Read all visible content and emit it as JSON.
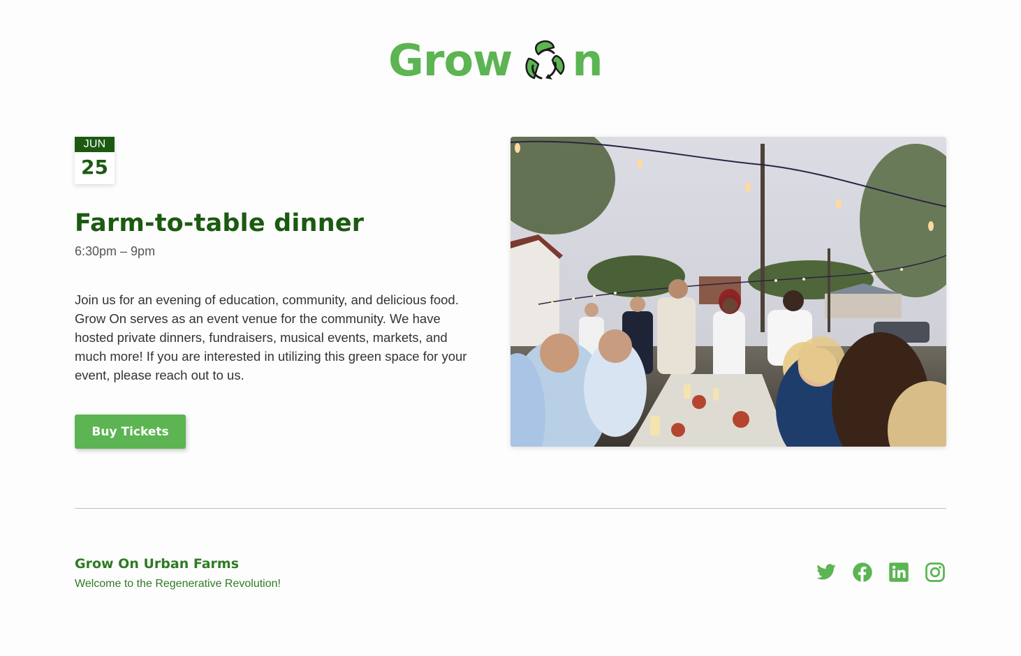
{
  "brand": {
    "logo_text_left": "Grow",
    "logo_text_right": "n",
    "accent_color": "#5cb452",
    "dark_green": "#1c5a12"
  },
  "event": {
    "date_month": "JUN",
    "date_day": "25",
    "title": "Farm-to-table dinner",
    "time": "6:30pm – 9pm",
    "description": "Join us for an evening of education, community, and delicious food. Grow On serves as an event venue for the community. We have hosted private dinners, fundraisers, musical events, markets, and much more! If you are interested in utilizing this green space for your event, please reach out to us.",
    "buy_button_label": "Buy Tickets",
    "photo_icon": "outdoor-dinner-photo"
  },
  "footer": {
    "org_name": "Grow On Urban Farms",
    "tagline": "Welcome to the Regenerative Revolution!",
    "social": [
      {
        "icon": "twitter-icon"
      },
      {
        "icon": "facebook-icon"
      },
      {
        "icon": "linkedin-icon"
      },
      {
        "icon": "instagram-icon"
      }
    ]
  }
}
